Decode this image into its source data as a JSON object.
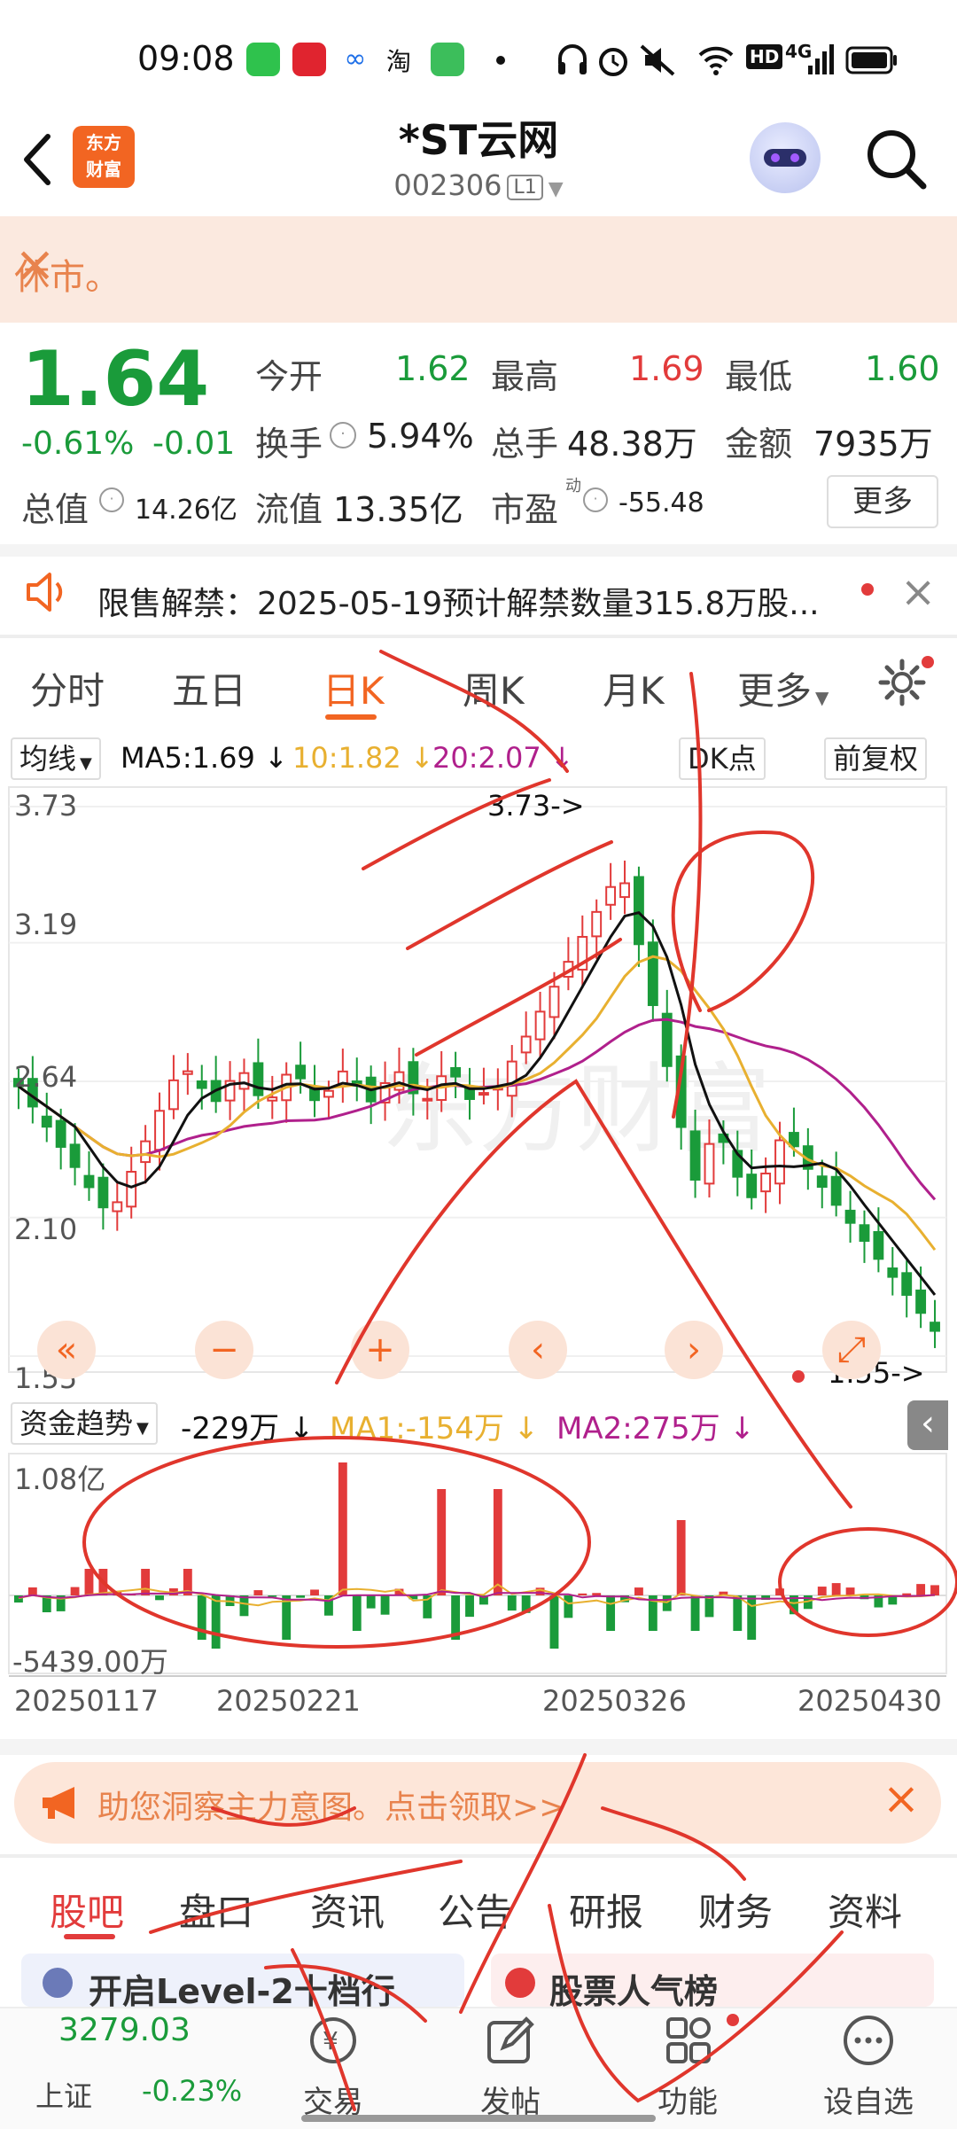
{
  "status_bar": {
    "time": "09:08",
    "net_label": "4G"
  },
  "header": {
    "title": "*ST云网",
    "code": "002306",
    "level": "L1",
    "logo_text_1": "东方",
    "logo_text_2": "财富"
  },
  "banner_closed": {
    "text": "休市。"
  },
  "quote": {
    "price": "1.64",
    "change_pct": "-0.61%",
    "change": "-0.01",
    "open_label": "今开",
    "open": "1.62",
    "high_label": "最高",
    "high": "1.69",
    "low_label": "最低",
    "low": "1.60",
    "turnover_label": "换手",
    "turnover": "5.94%",
    "volume_label": "总手",
    "volume": "48.38万",
    "amount_label": "金额",
    "amount": "7935万",
    "mcap_label": "总值",
    "mcap": "14.26亿",
    "float_label": "流值",
    "float_mcap": "13.35亿",
    "pe_label": "市盈",
    "pe_sup": "动",
    "pe": "-55.48",
    "more": "更多"
  },
  "notice": {
    "text": "限售解禁：2025-05-19预计解禁数量315.8万股..."
  },
  "period_tabs": [
    "分时",
    "五日",
    "日K",
    "周K",
    "月K",
    "更多"
  ],
  "kline": {
    "ma_selector": "均线",
    "ma5": "MA5:1.69",
    "ma10": "10:1.82",
    "ma20": "20:2.07",
    "dk": "DK点",
    "adjust": "前复权",
    "y_ticks": [
      "3.73",
      "3.19",
      "2.64",
      "2.10",
      "1.55"
    ],
    "high_marker": "3.73->",
    "low_marker": "1.55->",
    "fund_selector": "资金趋势",
    "fund_value": "-229万",
    "fund_ma1": "MA1:-154万",
    "fund_ma2": "MA2:275万",
    "fund_max": "1.08亿",
    "fund_min": "-5439.00万",
    "dates": [
      "20250117",
      "20250221",
      "20250326",
      "20250430"
    ],
    "colors": {
      "up": "#e23b3b",
      "down": "#1a9b3a",
      "ma5": "#111111",
      "ma10": "#e8b030",
      "ma20": "#b0208c"
    }
  },
  "promo": {
    "text": "助您洞察主力意图。点击领取>>"
  },
  "bottom_tabs": [
    "股吧",
    "盘口",
    "资讯",
    "公告",
    "研报",
    "财务",
    "资料"
  ],
  "cards": {
    "left": "开启Level-2十档行",
    "right": "股票人气榜"
  },
  "nav": {
    "index_value": "3279.03",
    "index_name": "上证",
    "index_change": "-0.23%",
    "trade": "交易",
    "post": "发帖",
    "func": "功能",
    "watch": "设自选"
  }
}
